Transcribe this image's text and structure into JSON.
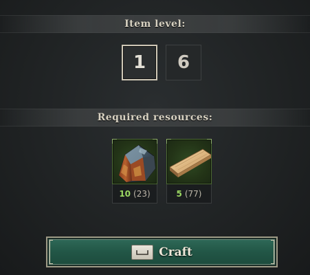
{
  "item_level": {
    "title": "Item level:",
    "options": [
      "1",
      "6"
    ],
    "selected": "1"
  },
  "resources": {
    "title": "Required resources:",
    "items": [
      {
        "icon": "ore-chunk-icon",
        "required": "10",
        "available": "(23)"
      },
      {
        "icon": "wooden-plank-icon",
        "required": "5",
        "available": "(77)"
      }
    ]
  },
  "craft": {
    "label": "Craft",
    "key_icon": "spacebar-key-icon"
  },
  "colors": {
    "have_count": "#9bd862",
    "craft_button": "#225646"
  }
}
